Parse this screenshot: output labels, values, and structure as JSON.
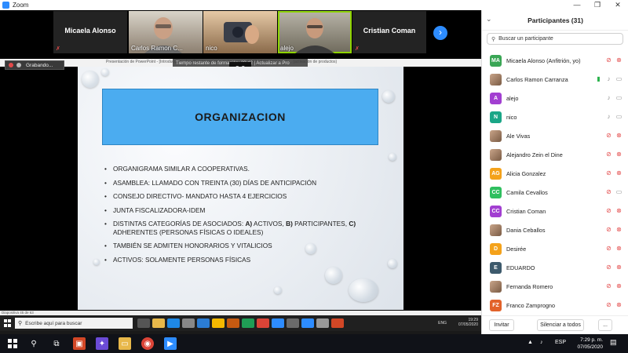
{
  "window": {
    "title": "Zoom",
    "minimize": "—",
    "maximize": "❐",
    "close": "✕"
  },
  "video_strip": {
    "tiles": [
      {
        "name": "Micaela Alonso",
        "type": "name"
      },
      {
        "name": "Carlos Ramon C...",
        "type": "camera"
      },
      {
        "name": "nico",
        "type": "camera"
      },
      {
        "name": "alejo",
        "type": "camera"
      },
      {
        "name": "Cristian Coman",
        "type": "name"
      }
    ],
    "next_icon": "chevron-right-icon"
  },
  "share": {
    "ppt_title": "Presentación de PowerPoint - [Introduccion ...] — Tiempo restante de formación: 39:42 | Actualizar a Pro ... (activación de productos)",
    "recording_label": "Grabando...",
    "timer_banner": "Tiempo restante de formación: 39:42 | Actualizar a Pro",
    "slide": {
      "title": "ORGANIZACION",
      "bullets": [
        {
          "pre": "Organigrama  similar a cooperativas.",
          "b1": "",
          "mid1": "",
          "b2": "",
          "mid2": "",
          "b3": "",
          "post": ""
        },
        {
          "pre": "Asamblea: llamado con treinta (30) días de anticipación",
          "b1": "",
          "mid1": "",
          "b2": "",
          "mid2": "",
          "b3": "",
          "post": ""
        },
        {
          "pre": "Consejo directivo- mandato hasta 4 ejercicios",
          "b1": "",
          "mid1": "",
          "b2": "",
          "mid2": "",
          "b3": "",
          "post": ""
        },
        {
          "pre": "Junta fiscalizadora-idem",
          "b1": "",
          "mid1": "",
          "b2": "",
          "mid2": "",
          "b3": "",
          "post": ""
        },
        {
          "pre": "Distintas categorías de asociados: ",
          "b1": "A)",
          "mid1": " activos, ",
          "b2": "B)",
          "mid2": " participantes, ",
          "b3": "C)",
          "post": " adherentes (personas físicas o ideales)"
        },
        {
          "pre": "También se admiten honorarios y vitalicios",
          "b1": "",
          "mid1": "",
          "b2": "",
          "mid2": "",
          "b3": "",
          "post": ""
        },
        {
          "pre": "Activos: solamente personas físicas",
          "b1": "",
          "mid1": "",
          "b2": "",
          "mid2": "",
          "b3": "",
          "post": ""
        }
      ]
    },
    "status": "Diapositiva 45 de 63",
    "inner_taskbar": {
      "search_placeholder": "Escribe aquí para buscar",
      "lang": "ENG",
      "time": "19:29",
      "date": "07/05/2020"
    }
  },
  "participants": {
    "title": "Participantes (31)",
    "search_placeholder": "Buscar un participante",
    "list": [
      {
        "name": "Micaela Alonso (Anfitrión, yo)",
        "initials": "MA",
        "color": "#3aa655",
        "photo": false,
        "mic": "muted",
        "cam": "off"
      },
      {
        "name": "Carlos Ramon Carranza",
        "initials": "",
        "color": "",
        "photo": true,
        "mic": "on",
        "cam": "on",
        "share": true
      },
      {
        "name": "alejo",
        "initials": "A",
        "color": "#a23fd1",
        "photo": false,
        "mic": "on",
        "cam": "on"
      },
      {
        "name": "nico",
        "initials": "N",
        "color": "#1aa687",
        "photo": false,
        "mic": "on",
        "cam": "on"
      },
      {
        "name": "Ale     Vivas",
        "initials": "",
        "color": "",
        "photo": true,
        "mic": "muted",
        "cam": "off"
      },
      {
        "name": "Alejandro Zein el Dine",
        "initials": "",
        "color": "",
        "photo": true,
        "mic": "muted",
        "cam": "off"
      },
      {
        "name": "Alicia Gonzalez",
        "initials": "AG",
        "color": "#f4a21b",
        "photo": false,
        "mic": "muted",
        "cam": "off"
      },
      {
        "name": "Camila Cevallos",
        "initials": "CC",
        "color": "#2fbf5f",
        "photo": false,
        "mic": "muted",
        "cam": "on"
      },
      {
        "name": "Cristian Coman",
        "initials": "CC",
        "color": "#a23fd1",
        "photo": false,
        "mic": "muted",
        "cam": "off"
      },
      {
        "name": "Dania Ceballos",
        "initials": "",
        "color": "",
        "photo": true,
        "mic": "muted",
        "cam": "off"
      },
      {
        "name": "Desirée",
        "initials": "D",
        "color": "#f4a21b",
        "photo": false,
        "mic": "muted",
        "cam": "off"
      },
      {
        "name": "EDUARDO",
        "initials": "E",
        "color": "#3d5a6c",
        "photo": false,
        "mic": "muted",
        "cam": "off"
      },
      {
        "name": "Fernanda Romero",
        "initials": "",
        "color": "",
        "photo": true,
        "mic": "muted",
        "cam": "off"
      },
      {
        "name": "Franco Zamprogno",
        "initials": "FZ",
        "color": "#e2622a",
        "photo": false,
        "mic": "muted",
        "cam": "off"
      }
    ],
    "invite": "Invitar",
    "mute_all": "Silenciar a todos",
    "more": "..."
  },
  "taskbar": {
    "lang": "ESP",
    "time": "7:29 p. m.",
    "date": "07/05/2020"
  }
}
